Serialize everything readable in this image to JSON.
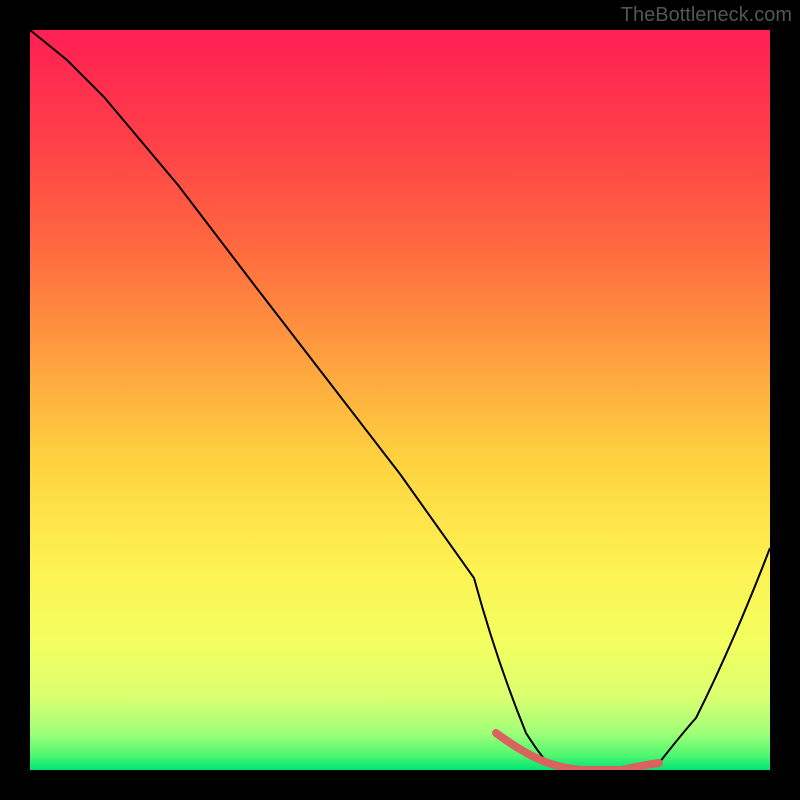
{
  "watermark": "TheBottleneck.com",
  "chart_data": {
    "type": "line",
    "title": "",
    "xlabel": "",
    "ylabel": "",
    "xlim": [
      0,
      100
    ],
    "ylim": [
      0,
      100
    ],
    "series": [
      {
        "name": "bottleneck-curve",
        "x": [
          0,
          5,
          10,
          20,
          30,
          40,
          50,
          60,
          63,
          67,
          70,
          75,
          80,
          85,
          90,
          95,
          100
        ],
        "y": [
          100,
          96,
          91,
          79,
          66,
          53,
          40,
          26,
          15,
          5,
          1,
          0,
          0,
          1,
          7,
          17,
          30
        ],
        "color": "#000000"
      },
      {
        "name": "optimal-range",
        "x": [
          63,
          67,
          70,
          75,
          80,
          85
        ],
        "y": [
          5,
          2,
          1,
          0,
          0,
          1
        ],
        "color": "#d9635f",
        "stroke_width": 6
      }
    ],
    "gradient_stops": [
      {
        "offset": 0,
        "color": "#ff1f54"
      },
      {
        "offset": 30,
        "color": "#ff6b3f"
      },
      {
        "offset": 55,
        "color": "#ffd23f"
      },
      {
        "offset": 80,
        "color": "#f9ff5c"
      },
      {
        "offset": 92,
        "color": "#d8ff7a"
      },
      {
        "offset": 97,
        "color": "#7aff7a"
      },
      {
        "offset": 100,
        "color": "#00e676"
      }
    ]
  }
}
